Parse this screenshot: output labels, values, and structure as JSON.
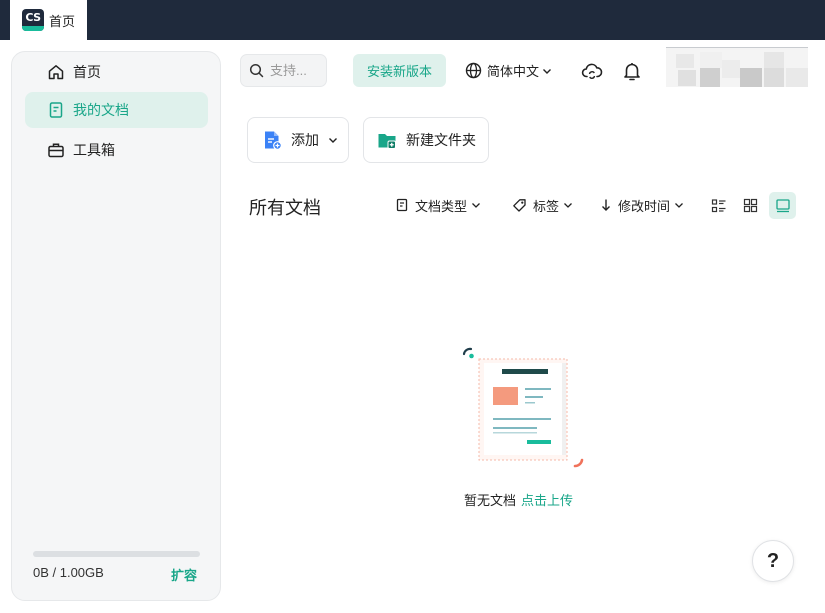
{
  "app": {
    "logo_text": "CS",
    "tab_label": "首页"
  },
  "sidebar": {
    "items": [
      {
        "label": "首页",
        "icon": "home-icon"
      },
      {
        "label": "我的文档",
        "icon": "document-icon",
        "active": true
      },
      {
        "label": "工具箱",
        "icon": "toolbox-icon"
      }
    ],
    "storage": {
      "used_text": "0B / 1.00GB",
      "used_fraction": 0,
      "expand_label": "扩容"
    }
  },
  "header": {
    "search_placeholder": "支持...",
    "install_label": "安装新版本",
    "language_label": "简体中文"
  },
  "actions": {
    "add_label": "添加",
    "new_folder_label": "新建文件夹"
  },
  "toolbar": {
    "title": "所有文档",
    "filters": {
      "doc_type": "文档类型",
      "tags": "标签",
      "sort": "修改时间"
    }
  },
  "empty_state": {
    "text": "暂无文档",
    "upload_link": "点击上传"
  },
  "help": {
    "label": "?"
  },
  "colors": {
    "accent": "#19a689",
    "topbar": "#1f2a3c",
    "active_bg": "#dff1ec",
    "doc_blue": "#3b82f6"
  }
}
